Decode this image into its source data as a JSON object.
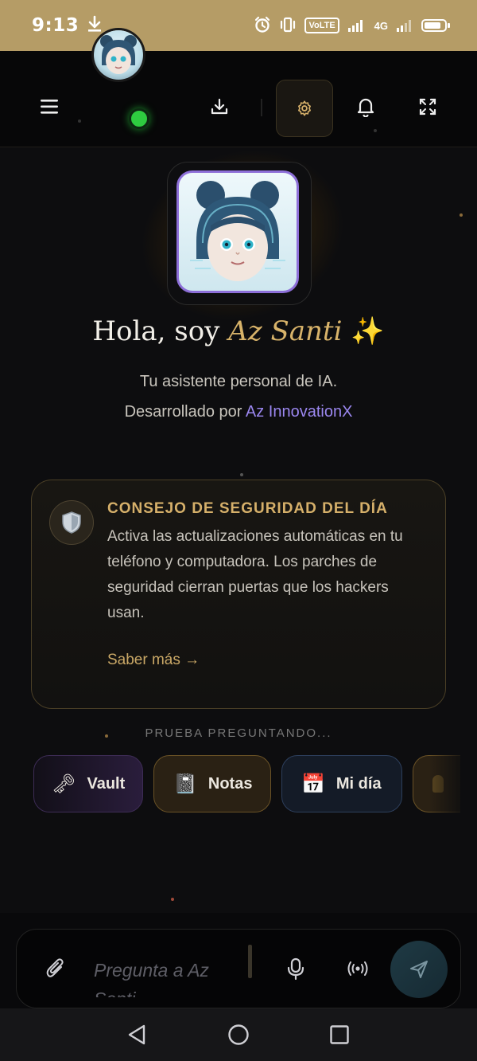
{
  "status_bar": {
    "time": "9:13",
    "volte": "VoLTE",
    "network": "4G",
    "accent_color": "#b59c66"
  },
  "app_bar": {
    "icons": [
      "menu-icon",
      "avatar",
      "download-icon",
      "settings-gear-icon",
      "bell-icon",
      "fullscreen-icon"
    ],
    "online_status_color": "#2ecc40"
  },
  "hero": {
    "greeting": "Hola, soy ",
    "assistant_name": "Az Santi",
    "sparkle": "✨",
    "subtitle": "Tu asistente personal de IA.",
    "developed_by": "Desarrollado por ",
    "brand": "Az InnovationX",
    "brand_color": "#9b87f0",
    "name_color": "#d8b36a"
  },
  "tip_card": {
    "title": "CONSEJO DE SEGURIDAD DEL DÍA",
    "body": "Activa las actualizaciones automáticas en tu teléfono y computadora. Los parches de seguridad cierran puertas que los hackers usan.",
    "link": "Saber más →",
    "icon": "shield-icon"
  },
  "suggestions": {
    "heading": "PRUEBA PREGUNTANDO...",
    "chips": [
      {
        "label": "Vault",
        "icon": "key-icon",
        "emoji": "🗝"
      },
      {
        "label": "Notas",
        "icon": "notebook-icon",
        "emoji": "📓"
      },
      {
        "label": "Mi día",
        "icon": "calendar-icon",
        "emoji": "📅"
      }
    ]
  },
  "composer": {
    "placeholder": "Pregunta a Az Santi"
  },
  "nav": {
    "icons": [
      "back-icon",
      "home-icon",
      "recents-icon"
    ]
  }
}
